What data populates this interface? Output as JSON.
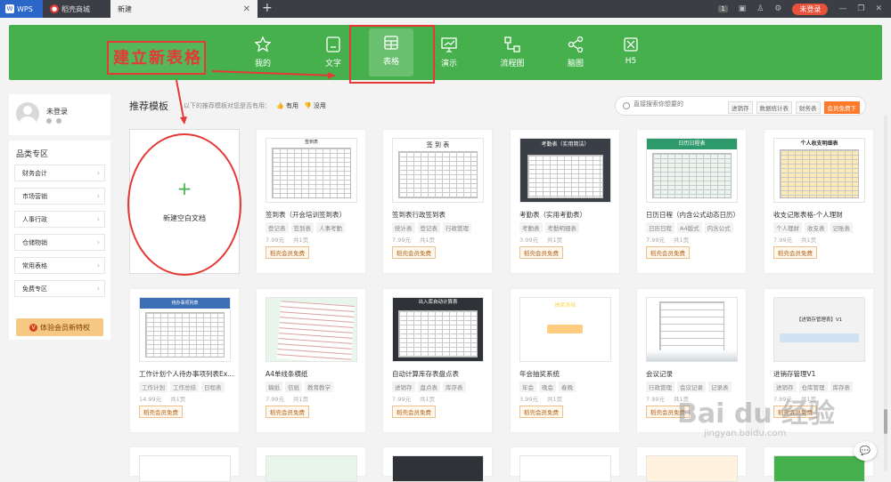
{
  "titlebar": {
    "tabs": [
      {
        "label": "WPS"
      },
      {
        "label": "稻壳商城"
      },
      {
        "label": "新建"
      }
    ],
    "badge": "1",
    "login": "未登录"
  },
  "nav": {
    "annotation": "建立新表格",
    "items": [
      {
        "label": "我的",
        "icon": "star-icon"
      },
      {
        "label": "文字",
        "icon": "document-icon"
      },
      {
        "label": "表格",
        "icon": "table-icon"
      },
      {
        "label": "演示",
        "icon": "presentation-icon"
      },
      {
        "label": "流程图",
        "icon": "flowchart-icon"
      },
      {
        "label": "脑图",
        "icon": "mindmap-icon"
      },
      {
        "label": "H5",
        "icon": "h5-icon"
      }
    ]
  },
  "sidebar": {
    "user": "未登录",
    "category_title": "品类专区",
    "categories": [
      "财务会计",
      "市场营销",
      "人事行政",
      "仓储物销",
      "常用表格",
      "免费专区"
    ],
    "vip": "体验会员新特权"
  },
  "main": {
    "section_title": "推荐模板",
    "feedback": {
      "question": "以下的推荐模板对您是否有用：",
      "yes": "有用",
      "no": "没用"
    },
    "search": {
      "placeholder": "直接搜索你想要的",
      "tags": [
        "进销存",
        "数据统计表",
        "财务表",
        "会员免费下"
      ]
    },
    "new_blank": "新建空白文档",
    "cards_row1": [
      {
        "title": "签到表（开会培训签到表）",
        "tags": [
          "登记表",
          "签到表",
          "人事考勤"
        ],
        "price": "7.99元",
        "pages": "共1页",
        "free": "稻壳会员免费",
        "thumb_title": "签到表"
      },
      {
        "title": "签到表行政签到表",
        "tags": [
          "统计表",
          "登记表",
          "行政管理"
        ],
        "price": "7.99元",
        "pages": "共1页",
        "free": "稻壳会员免费",
        "thumb_title": "签 到 表"
      },
      {
        "title": "考勤表（实用考勤表）",
        "tags": [
          "考勤表",
          "考勤明细表"
        ],
        "price": "3.99元",
        "pages": "共1页",
        "free": "稻壳会员免费",
        "thumb_title": "考勤表（实用简洁）"
      },
      {
        "title": "日历日程（内含公式动态日历）",
        "tags": [
          "日历日程",
          "A4版式",
          "内含公式"
        ],
        "price": "7.99元",
        "pages": "共1页",
        "free": "稻壳会员免费",
        "thumb_title": "日历日程表"
      },
      {
        "title": "收支记账表格-个人理财",
        "tags": [
          "个人理财",
          "收支表",
          "记账表"
        ],
        "price": "7.99元",
        "pages": "共1页",
        "free": "稻壳会员免费",
        "thumb_title": "个人收支明细表"
      }
    ],
    "cards_row2": [
      {
        "title": "工作计划个人待办事项列表Ex...",
        "tags": [
          "工作计划",
          "工作总结",
          "日程表"
        ],
        "price": "14.99元",
        "pages": "共1页",
        "free": "稻壳会员免费",
        "thumb_title": "待办事项列表"
      },
      {
        "title": "A4单线条横纸",
        "tags": [
          "稿纸",
          "信纸",
          "教育教学"
        ],
        "price": "7.99元",
        "pages": "共1页",
        "free": "稻壳会员免费",
        "thumb_title": ""
      },
      {
        "title": "自动计算库存表盘点表",
        "tags": [
          "进销存",
          "盘点表",
          "库存表"
        ],
        "price": "7.99元",
        "pages": "共1页",
        "free": "稻壳会员免费",
        "thumb_title": "出入库自动计算表"
      },
      {
        "title": "年会抽奖系统",
        "tags": [
          "年会",
          "晚会",
          "春晚"
        ],
        "price": "3.99元",
        "pages": "共1页",
        "free": "稻壳会员免费",
        "thumb_title": "抽奖系统"
      },
      {
        "title": "会议记录",
        "tags": [
          "行政管理",
          "会议记录",
          "记录表"
        ],
        "price": "7.99元",
        "pages": "共1页",
        "free": "稻壳会员免费",
        "thumb_title": ""
      },
      {
        "title": "进销存管理V1",
        "tags": [
          "进销存",
          "仓库管理",
          "库存表"
        ],
        "price": "7.99元",
        "pages": "共1页",
        "free": "稻壳会员免费",
        "thumb_title": "【进销存管理表】V1"
      }
    ]
  },
  "watermark": {
    "logo": "Bai du 经验",
    "url": "jingyan.baidu.com"
  }
}
